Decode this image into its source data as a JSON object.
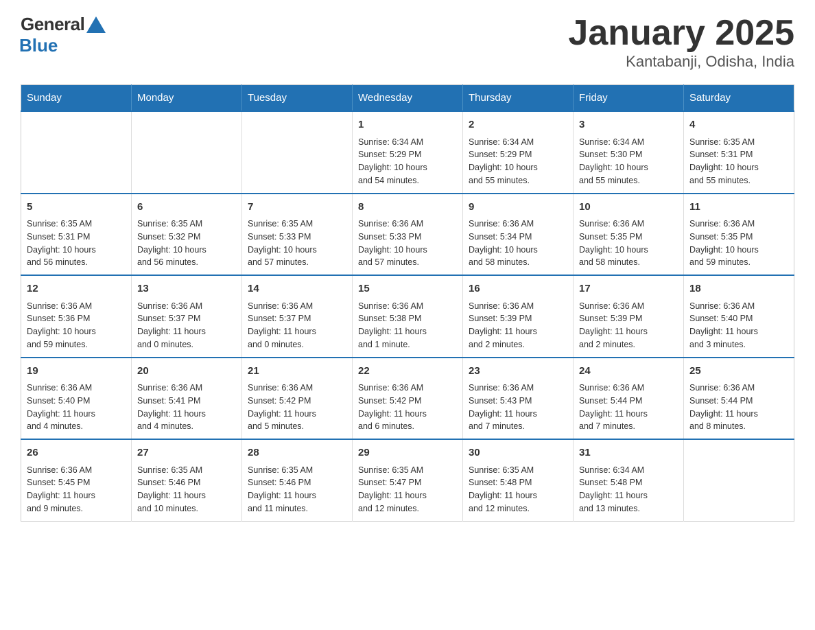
{
  "logo": {
    "general": "General",
    "blue": "Blue"
  },
  "header": {
    "month": "January 2025",
    "location": "Kantabanji, Odisha, India"
  },
  "weekdays": [
    "Sunday",
    "Monday",
    "Tuesday",
    "Wednesday",
    "Thursday",
    "Friday",
    "Saturday"
  ],
  "weeks": [
    [
      {
        "day": "",
        "info": ""
      },
      {
        "day": "",
        "info": ""
      },
      {
        "day": "",
        "info": ""
      },
      {
        "day": "1",
        "info": "Sunrise: 6:34 AM\nSunset: 5:29 PM\nDaylight: 10 hours\nand 54 minutes."
      },
      {
        "day": "2",
        "info": "Sunrise: 6:34 AM\nSunset: 5:29 PM\nDaylight: 10 hours\nand 55 minutes."
      },
      {
        "day": "3",
        "info": "Sunrise: 6:34 AM\nSunset: 5:30 PM\nDaylight: 10 hours\nand 55 minutes."
      },
      {
        "day": "4",
        "info": "Sunrise: 6:35 AM\nSunset: 5:31 PM\nDaylight: 10 hours\nand 55 minutes."
      }
    ],
    [
      {
        "day": "5",
        "info": "Sunrise: 6:35 AM\nSunset: 5:31 PM\nDaylight: 10 hours\nand 56 minutes."
      },
      {
        "day": "6",
        "info": "Sunrise: 6:35 AM\nSunset: 5:32 PM\nDaylight: 10 hours\nand 56 minutes."
      },
      {
        "day": "7",
        "info": "Sunrise: 6:35 AM\nSunset: 5:33 PM\nDaylight: 10 hours\nand 57 minutes."
      },
      {
        "day": "8",
        "info": "Sunrise: 6:36 AM\nSunset: 5:33 PM\nDaylight: 10 hours\nand 57 minutes."
      },
      {
        "day": "9",
        "info": "Sunrise: 6:36 AM\nSunset: 5:34 PM\nDaylight: 10 hours\nand 58 minutes."
      },
      {
        "day": "10",
        "info": "Sunrise: 6:36 AM\nSunset: 5:35 PM\nDaylight: 10 hours\nand 58 minutes."
      },
      {
        "day": "11",
        "info": "Sunrise: 6:36 AM\nSunset: 5:35 PM\nDaylight: 10 hours\nand 59 minutes."
      }
    ],
    [
      {
        "day": "12",
        "info": "Sunrise: 6:36 AM\nSunset: 5:36 PM\nDaylight: 10 hours\nand 59 minutes."
      },
      {
        "day": "13",
        "info": "Sunrise: 6:36 AM\nSunset: 5:37 PM\nDaylight: 11 hours\nand 0 minutes."
      },
      {
        "day": "14",
        "info": "Sunrise: 6:36 AM\nSunset: 5:37 PM\nDaylight: 11 hours\nand 0 minutes."
      },
      {
        "day": "15",
        "info": "Sunrise: 6:36 AM\nSunset: 5:38 PM\nDaylight: 11 hours\nand 1 minute."
      },
      {
        "day": "16",
        "info": "Sunrise: 6:36 AM\nSunset: 5:39 PM\nDaylight: 11 hours\nand 2 minutes."
      },
      {
        "day": "17",
        "info": "Sunrise: 6:36 AM\nSunset: 5:39 PM\nDaylight: 11 hours\nand 2 minutes."
      },
      {
        "day": "18",
        "info": "Sunrise: 6:36 AM\nSunset: 5:40 PM\nDaylight: 11 hours\nand 3 minutes."
      }
    ],
    [
      {
        "day": "19",
        "info": "Sunrise: 6:36 AM\nSunset: 5:40 PM\nDaylight: 11 hours\nand 4 minutes."
      },
      {
        "day": "20",
        "info": "Sunrise: 6:36 AM\nSunset: 5:41 PM\nDaylight: 11 hours\nand 4 minutes."
      },
      {
        "day": "21",
        "info": "Sunrise: 6:36 AM\nSunset: 5:42 PM\nDaylight: 11 hours\nand 5 minutes."
      },
      {
        "day": "22",
        "info": "Sunrise: 6:36 AM\nSunset: 5:42 PM\nDaylight: 11 hours\nand 6 minutes."
      },
      {
        "day": "23",
        "info": "Sunrise: 6:36 AM\nSunset: 5:43 PM\nDaylight: 11 hours\nand 7 minutes."
      },
      {
        "day": "24",
        "info": "Sunrise: 6:36 AM\nSunset: 5:44 PM\nDaylight: 11 hours\nand 7 minutes."
      },
      {
        "day": "25",
        "info": "Sunrise: 6:36 AM\nSunset: 5:44 PM\nDaylight: 11 hours\nand 8 minutes."
      }
    ],
    [
      {
        "day": "26",
        "info": "Sunrise: 6:36 AM\nSunset: 5:45 PM\nDaylight: 11 hours\nand 9 minutes."
      },
      {
        "day": "27",
        "info": "Sunrise: 6:35 AM\nSunset: 5:46 PM\nDaylight: 11 hours\nand 10 minutes."
      },
      {
        "day": "28",
        "info": "Sunrise: 6:35 AM\nSunset: 5:46 PM\nDaylight: 11 hours\nand 11 minutes."
      },
      {
        "day": "29",
        "info": "Sunrise: 6:35 AM\nSunset: 5:47 PM\nDaylight: 11 hours\nand 12 minutes."
      },
      {
        "day": "30",
        "info": "Sunrise: 6:35 AM\nSunset: 5:48 PM\nDaylight: 11 hours\nand 12 minutes."
      },
      {
        "day": "31",
        "info": "Sunrise: 6:34 AM\nSunset: 5:48 PM\nDaylight: 11 hours\nand 13 minutes."
      },
      {
        "day": "",
        "info": ""
      }
    ]
  ]
}
